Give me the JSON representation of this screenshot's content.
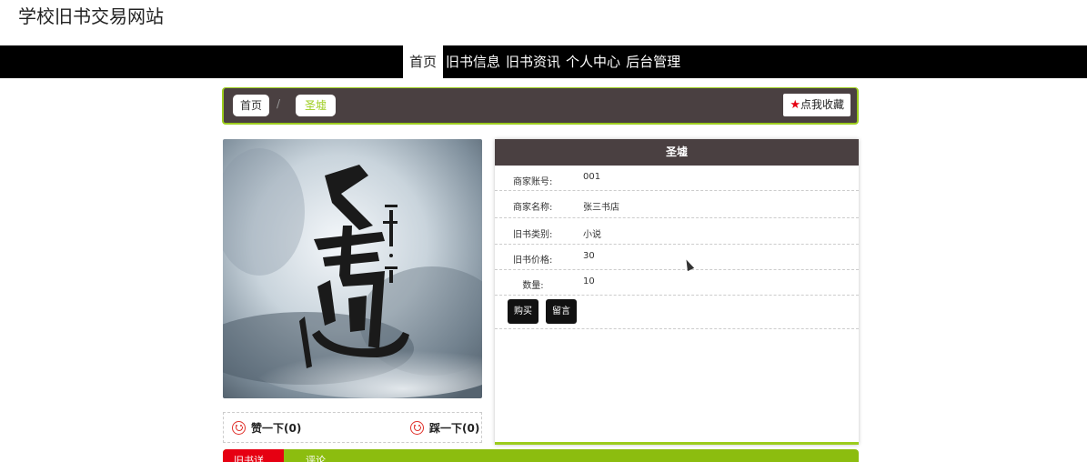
{
  "site": {
    "title": "学校旧书交易网站"
  },
  "nav": {
    "items": [
      {
        "label": "首页",
        "active": true
      },
      {
        "label": "旧书信息",
        "active": false
      },
      {
        "label": "旧书资讯",
        "active": false
      },
      {
        "label": "个人中心",
        "active": false
      },
      {
        "label": "后台管理",
        "active": false
      }
    ]
  },
  "breadcrumb": {
    "home": "首页",
    "separator": "/",
    "current": "圣墟",
    "favorite_label": "点我收藏",
    "favorite_icon": "star-icon"
  },
  "cover": {
    "title_text": "圣墟",
    "author_text": "辰东·著"
  },
  "votes": {
    "up_label": "赞一下(0)",
    "down_label": "踩一下(0)",
    "icon": "smile-icon"
  },
  "detail": {
    "title": "圣墟",
    "fields": [
      {
        "label": "商家账号:",
        "value": "001"
      },
      {
        "label": "商家名称:",
        "value": "张三书店"
      },
      {
        "label": "旧书类别:",
        "value": "小说"
      },
      {
        "label": "旧书价格:",
        "value": "30"
      },
      {
        "label": "数量:",
        "value": "10"
      }
    ],
    "buy_label": "购买",
    "message_label": "留言"
  },
  "tabs": [
    {
      "label": "旧书详情",
      "active": true
    },
    {
      "label": "评论",
      "active": false
    }
  ],
  "colors": {
    "accent": "#9ccc1d",
    "dark": "#4a4041",
    "nav_bg": "#000000",
    "favorite_star": "#e60012",
    "active_tab": "#e60012"
  }
}
